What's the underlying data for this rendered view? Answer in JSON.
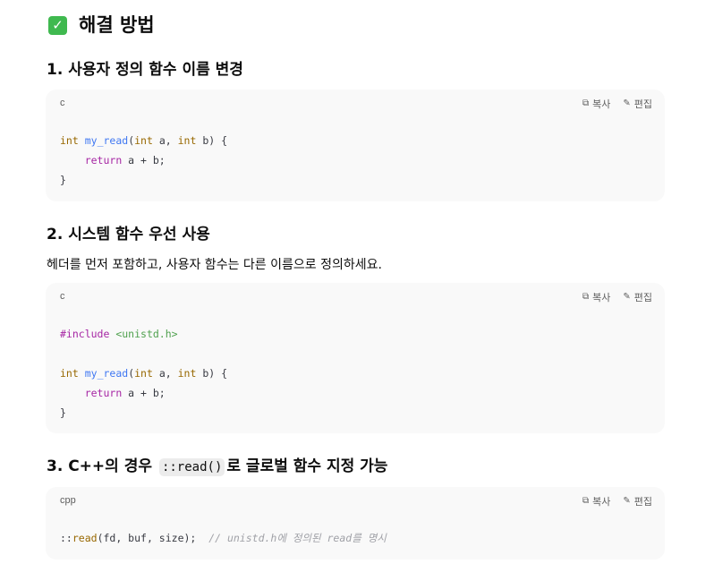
{
  "heading": {
    "icon": "check-mark-icon",
    "title": "해결 방법"
  },
  "sections": [
    {
      "title": "1. 사용자 정의 함수 이름 변경"
    },
    {
      "title": "2. 시스템 함수 우선 사용",
      "paragraph": "헤더를 먼저 포함하고, 사용자 함수는 다른 이름으로 정의하세요."
    },
    {
      "title_before": "3. C++의 경우",
      "inline_code": "::read()",
      "title_after": "로 글로벌 함수 지정 가능"
    }
  ],
  "code_actions": {
    "copy_label": "복사",
    "edit_label": "편집",
    "copy_icon": "copy-icon",
    "edit_icon": "pencil-icon"
  },
  "code_blocks": [
    {
      "lang": "c",
      "tokens": {
        "l1_kw": "int",
        "l1_fn": "my_read",
        "l1_p1": "(",
        "l1_kw2": "int",
        "l1_p2": " a, ",
        "l1_kw3": "int",
        "l1_p3": " b) {",
        "l2_indent": "    ",
        "l2_ret": "return",
        "l2_rest": " a + b;",
        "l3": "}"
      }
    },
    {
      "lang": "c",
      "tokens": {
        "l1_pp": "#include",
        "l1_sp": " ",
        "l1_str": "<unistd.h>",
        "l3_kw": "int",
        "l3_fn": "my_read",
        "l3_p1": "(",
        "l3_kw2": "int",
        "l3_p2": " a, ",
        "l3_kw3": "int",
        "l3_p3": " b) {",
        "l4_indent": "    ",
        "l4_ret": "return",
        "l4_rest": " a + b;",
        "l5": "}"
      }
    },
    {
      "lang": "cpp",
      "tokens": {
        "l1_scope": "::",
        "l1_fn": "read",
        "l1_args": "(fd, buf, size);  ",
        "l1_cm": "// unistd.h에 정의된 read를 명시"
      }
    }
  ],
  "colors": {
    "keyword": "#986801",
    "function": "#4078f2",
    "return": "#a626a4",
    "string": "#50a14f",
    "comment": "#a0a1a7",
    "check": "#3fb94f",
    "code_bg": "#f9f9f9"
  }
}
